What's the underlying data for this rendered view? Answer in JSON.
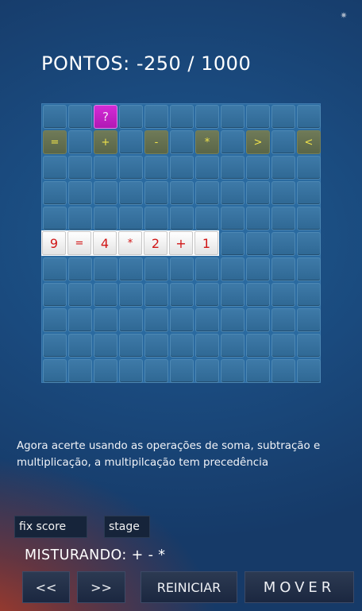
{
  "corner_icon": "settings-gear-icon",
  "score": "PONTOS: -250 / 1000",
  "board": {
    "cols": 11,
    "rows": 11,
    "purple_tile": {
      "row": 0,
      "col": 2,
      "text": "?"
    },
    "operator_row": {
      "row": 1,
      "tiles": [
        {
          "col": 0,
          "text": "="
        },
        {
          "col": 2,
          "text": "+"
        },
        {
          "col": 4,
          "text": "-"
        },
        {
          "col": 6,
          "text": "*"
        },
        {
          "col": 8,
          "text": ">"
        },
        {
          "col": 10,
          "text": "<"
        }
      ]
    },
    "equation": {
      "row": 5,
      "tiles": [
        "9",
        "=",
        "4",
        "*",
        "2",
        "+",
        "1"
      ]
    }
  },
  "hint": "Agora acerte usando as operações de soma, subtração e multiplicação, a multipilcação tem precedência",
  "buttons": {
    "fix_score": "fix score",
    "stage": "stage",
    "prev": "<<",
    "next": ">>",
    "restart": "REINICIAR",
    "move": "MOVER"
  },
  "mix_label": "MISTURANDO: + - *"
}
